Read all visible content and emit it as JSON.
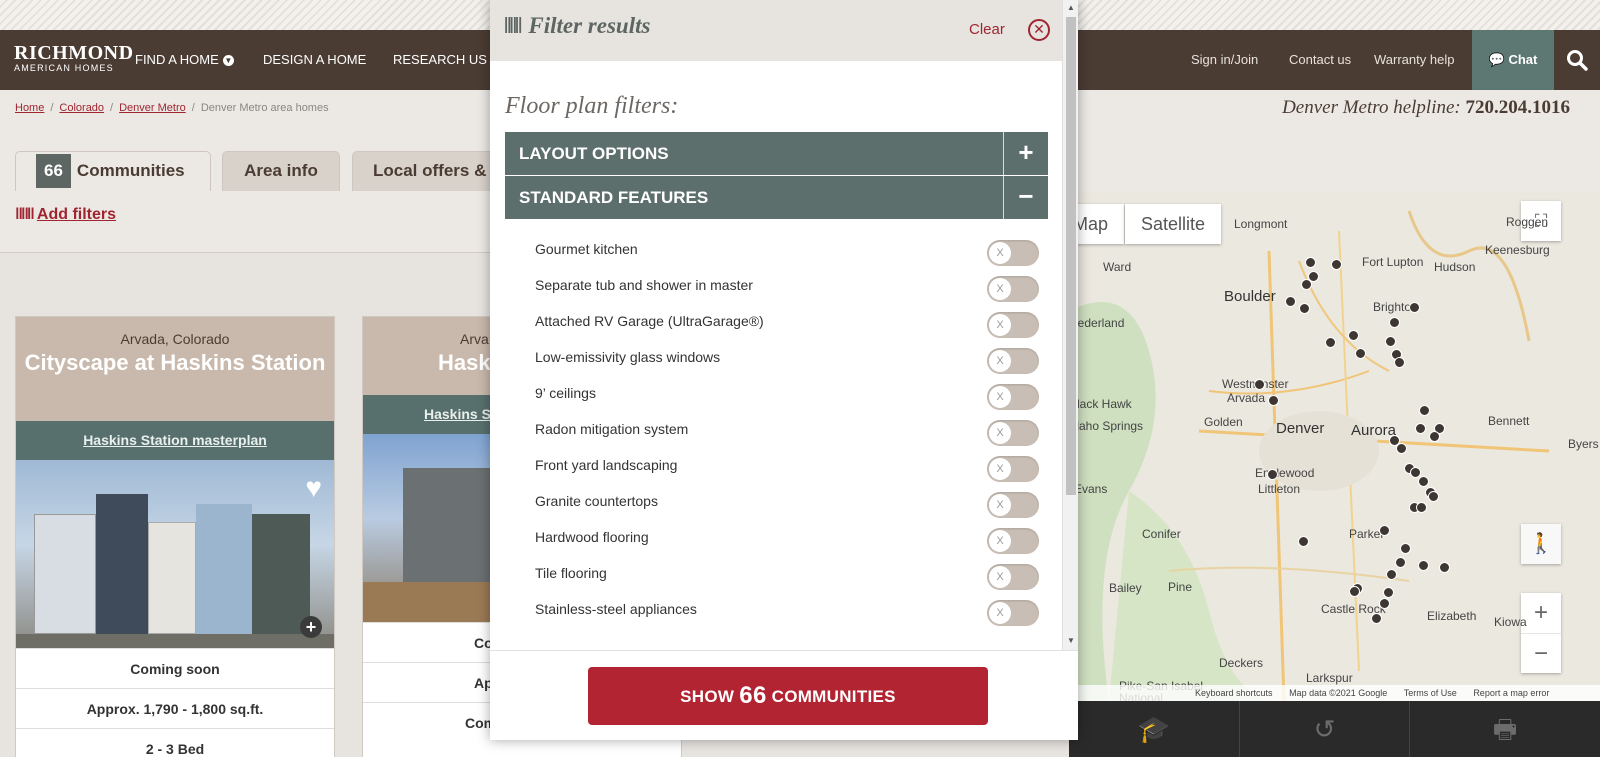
{
  "header": {
    "logo_line1": "RICHMOND",
    "logo_line2": "AMERICAN HOMES",
    "nav": [
      "FIND A HOME",
      "DESIGN A HOME",
      "RESEARCH US"
    ],
    "right_links": [
      "Sign in/Join",
      "Contact us",
      "Warranty help"
    ],
    "chat_label": "Chat"
  },
  "breadcrumb": {
    "items": [
      "Home",
      "Colorado",
      "Denver Metro"
    ],
    "current": "Denver Metro area homes"
  },
  "helpline": {
    "label": "Denver Metro helpline:",
    "phone": "720.204.1016"
  },
  "tabs": {
    "count": "66",
    "communities": "Communities",
    "area_info": "Area info",
    "local_offers": "Local offers & e"
  },
  "add_filters": "Add filters",
  "cards": [
    {
      "location": "Arvada, Colorado",
      "name": "Cityscape at Haskins Station",
      "masterplan": "Haskins Station masterplan",
      "rows": [
        "Coming soon",
        "Approx. 1,790 - 1,800 sq.ft.",
        "2 - 3 Bed"
      ]
    },
    {
      "location": "Arva",
      "name": "Haski",
      "masterplan": "Haskins St",
      "rows": [
        "Co",
        "App",
        "Comi"
      ]
    }
  ],
  "map": {
    "map_btn": "Map",
    "satellite_btn": "Satellite",
    "labels": [
      "Longmont",
      "Roggen",
      "Keenesburg",
      "Fort Lupton",
      "Hudson",
      "Ward",
      "Boulder",
      "Brighton",
      "Nederland",
      "Westminster",
      "Arvada",
      "Black Hawk",
      "Golden",
      "Denver",
      "Aurora",
      "Bennett",
      "Byers",
      "Idaho Springs",
      "Englewood",
      "Littleton",
      "Evans",
      "Conifer",
      "Parker",
      "Bailey",
      "Pine",
      "Castle Rock",
      "Elizabeth",
      "Kiowa",
      "Deckers",
      "Larkspur",
      "Pike-San Isabel National"
    ],
    "footer": [
      "Keyboard shortcuts",
      "Map data ©2021 Google",
      "Terms of Use",
      "Report a map error"
    ]
  },
  "modal": {
    "title": "Filter results",
    "clear": "Clear",
    "section_title": "Floor plan filters:",
    "accordions": [
      {
        "label": "LAYOUT OPTIONS",
        "toggle": "+"
      },
      {
        "label": "STANDARD FEATURES",
        "toggle": "−"
      }
    ],
    "features": [
      "Gourmet kitchen",
      "Separate tub and shower in master",
      "Attached RV Garage (UltraGarage®)",
      "Low-emissivity glass windows",
      "9’ ceilings",
      "Radon mitigation system",
      "Front yard landscaping",
      "Granite countertops",
      "Hardwood flooring",
      "Tile flooring",
      "Stainless-steel appliances"
    ],
    "switch_knob": "X",
    "show_button": {
      "prefix": "SHOW",
      "count": "66",
      "suffix": "COMMUNITIES"
    }
  }
}
